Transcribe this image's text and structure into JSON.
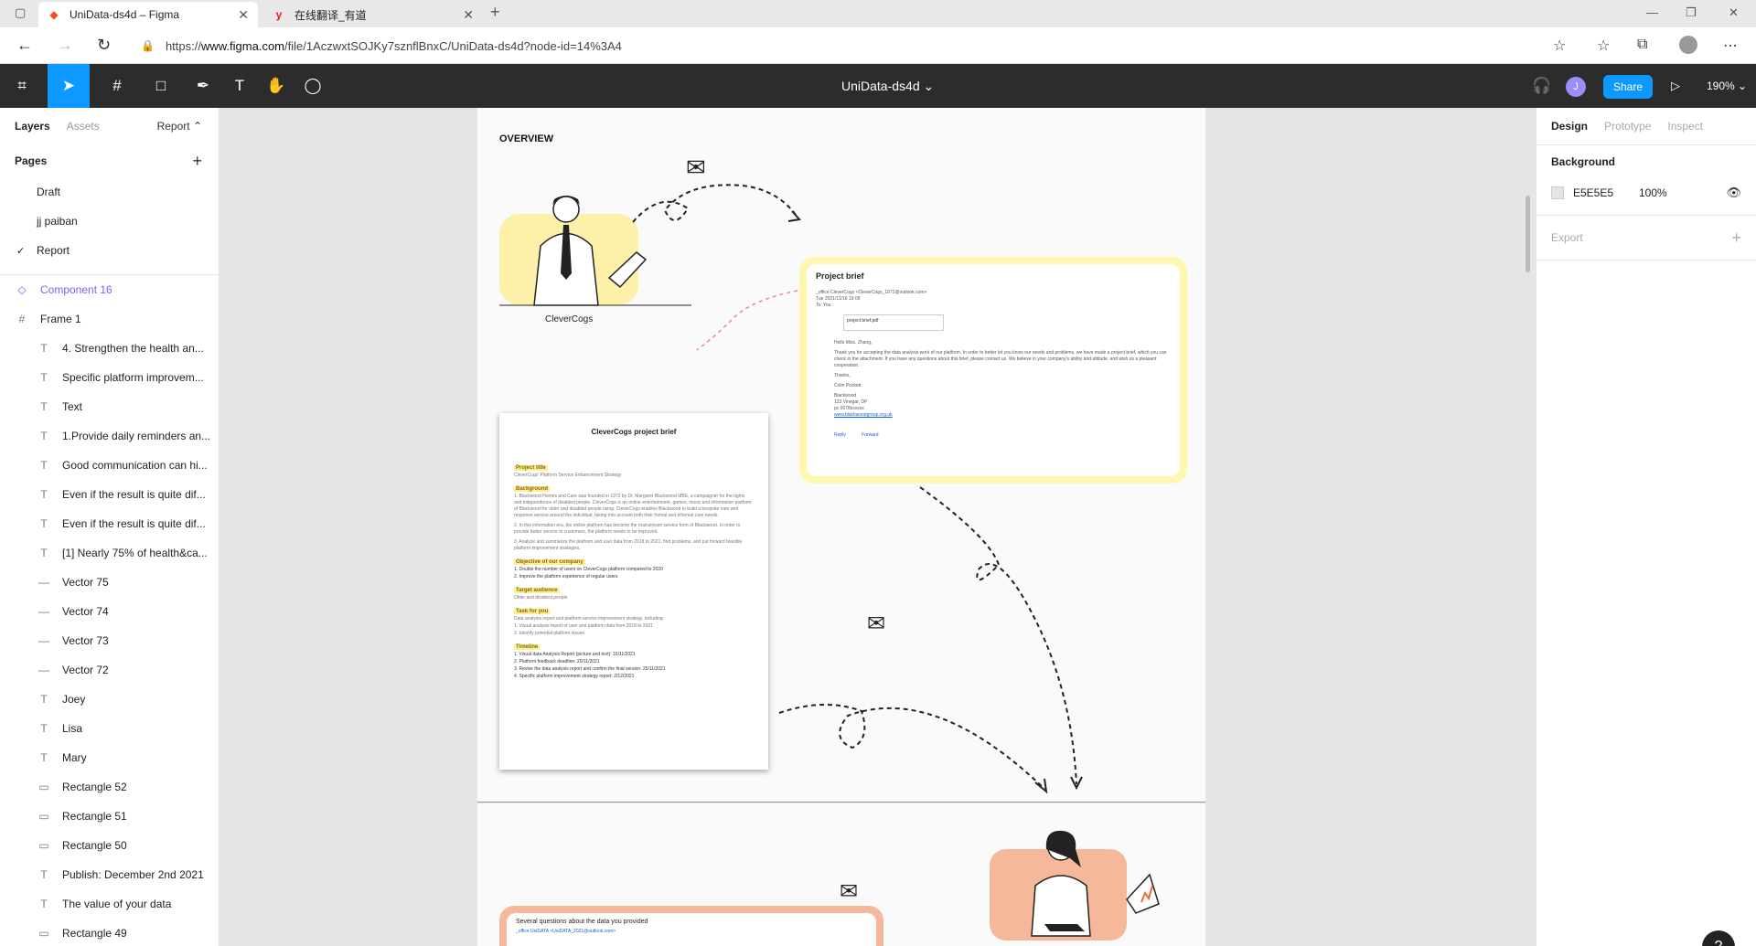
{
  "browser": {
    "tabs": [
      {
        "title": "UniData-ds4d – Figma",
        "icon": "figma-icon"
      },
      {
        "title": "在线翻译_有道",
        "icon": "youdao-icon"
      }
    ],
    "url_prefix": "https://",
    "url_host": "www.figma.com",
    "url_path": "/file/1AczwxtSOJKy7sznflBnxC/UniData-ds4d?node-id=14%3A4"
  },
  "toolbar": {
    "doc_title": "UniData-ds4d",
    "avatar_initial": "J",
    "share_label": "Share",
    "zoom": "190%"
  },
  "left_panel": {
    "tabs": [
      "Layers",
      "Assets"
    ],
    "page_selector": "Report ⌃",
    "pages_heading": "Pages",
    "pages": [
      "Draft",
      "jj paiban",
      "Report"
    ],
    "selected_page": "Report",
    "top_layers": [
      {
        "name": "Component 16",
        "type": "component"
      },
      {
        "name": "Frame 1",
        "type": "frame"
      }
    ],
    "child_layers": [
      {
        "name": "4. Strengthen the health an...",
        "type": "text"
      },
      {
        "name": "Specific platform improvem...",
        "type": "text"
      },
      {
        "name": "Text",
        "type": "text"
      },
      {
        "name": "1.Provide daily reminders an...",
        "type": "text"
      },
      {
        "name": "Good communication can hi...",
        "type": "text"
      },
      {
        "name": "Even if the result is quite dif...",
        "type": "text"
      },
      {
        "name": "Even if the result is quite dif...",
        "type": "text"
      },
      {
        "name": "[1] Nearly 75% of health&ca...",
        "type": "text"
      },
      {
        "name": "Vector 75",
        "type": "vector"
      },
      {
        "name": "Vector 74",
        "type": "vector"
      },
      {
        "name": "Vector 73",
        "type": "vector"
      },
      {
        "name": "Vector 72",
        "type": "vector"
      },
      {
        "name": "Joey",
        "type": "text"
      },
      {
        "name": "Lisa",
        "type": "text"
      },
      {
        "name": "Mary",
        "type": "text"
      },
      {
        "name": "Rectangle 52",
        "type": "rect"
      },
      {
        "name": "Rectangle 51",
        "type": "rect"
      },
      {
        "name": "Rectangle 50",
        "type": "rect"
      },
      {
        "name": "Publish: December 2nd 2021",
        "type": "text"
      },
      {
        "name": "The value of your data",
        "type": "text"
      },
      {
        "name": "Rectangle 49",
        "type": "rect"
      }
    ]
  },
  "canvas": {
    "overview_label": "OVERVIEW",
    "clevercogs_label": "CleverCogs",
    "project_brief_title": "Project brief",
    "email_from": "_office CleverCogs <CleverCogs_1972@outlook.com>",
    "email_date": "Tue 2021/11/16 19:09",
    "email_to": "To: You",
    "email_attachment": "project brief.pdf",
    "email_body": [
      "Hello Miss. Zhang,",
      "Thank you for accepting the data analysis work of our platform. In order to better let you know our needs and problems, we have made a project brief, which you can check in the attachment. If you have any questions about this brief, please contact us. We believe in your company's ability and attitude, and wish us a pleasant cooperation.",
      "Thanks,",
      "Colin Pockett",
      "Blackwood",
      "123 Vinegar, DP",
      "pc 0078xxxxxx",
      "www.blackwoodgroup.org.uk"
    ],
    "email_reply": "Reply",
    "email_forward": "Forward",
    "doc_title": "CleverCogs project brief",
    "doc_sections": [
      {
        "heading": "Project title",
        "lines": [
          "CleverCogs' Platform Service Enhancement Strategy"
        ]
      },
      {
        "heading": "Background",
        "lines": [
          "1. Blackwood Homes and Care was founded in 1972 by Dr. Margaret Blackwood MBE, a campaigner for the rights and independence of disabled people. CleverCogs is an online entertainment, games, music and information platform of Blackwood for older and disabled people using. CleverCogs enables Blackwood to build a bespoke care and response service around the individual, taking into account both their formal and informal care needs.",
          "2. In this information era, the online platform has become the mainstream service form of Blackwood. In order to provide better service to customers, the platform needs to be improved.",
          "3. Analyze and summarize the platform and user data from 2018 to 2021, find problems, and put forward feasible platform improvement strategies."
        ]
      },
      {
        "heading": "Objective of our company",
        "lines": [
          "1. Double the number of users on CleverCogs platform compared to 2020",
          "2. Improve the platform experience of regular users"
        ]
      },
      {
        "heading": "Target audience",
        "lines": [
          "Older and disabled people"
        ]
      },
      {
        "heading": "Task for you",
        "lines": [
          "Data analysis report and platform service improvement strategy, including:",
          "1. Visual analysis report of user and platform data from 2018 to 2021",
          "2. Identify potential platform issues"
        ]
      },
      {
        "heading": "Timeline",
        "lines": [
          "1. Visual data Analysis Report (picture and text): 15/11/2021",
          "2. Platform feedback deadline: 20/11/2021",
          "3. Revise the data analysis report and confirm the final version: 25/11/2021",
          "4. Specific platform improvement strategy report: 2/12/2021"
        ]
      }
    ],
    "questions_title": "Several questions about the data you provided",
    "questions_from": "_office UniDATA <UniDATA_2021@outlook.com>"
  },
  "right_panel": {
    "tabs": [
      "Design",
      "Prototype",
      "Inspect"
    ],
    "background_heading": "Background",
    "bg_hex": "E5E5E5",
    "bg_opacity": "100%",
    "export_label": "Export"
  },
  "colors": {
    "figma_blue": "#0d99ff",
    "toolbar_bg": "#2c2c2c",
    "canvas_bg": "#e5e5e5",
    "yellow_card": "#fff6b0",
    "peach_card": "#f5b89a"
  }
}
